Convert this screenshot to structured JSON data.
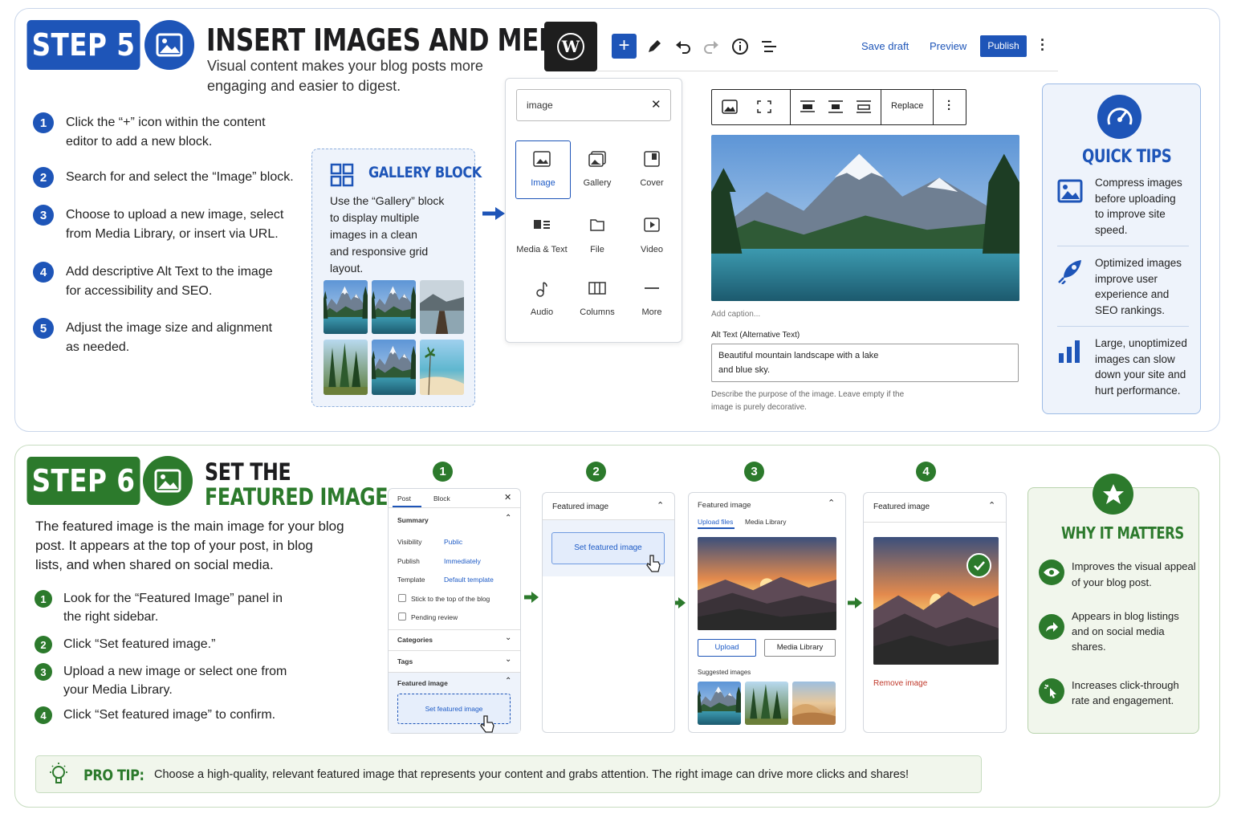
{
  "step5": {
    "badge": "STEP 5",
    "title": "INSERT IMAGES AND MEDIA",
    "subtitle_line1": "Visual content makes your blog posts more",
    "subtitle_line2": "engaging and easier to digest.",
    "steps": [
      {
        "n": "1",
        "l1": "Click the “+” icon within the content",
        "l2": "editor to add a new block."
      },
      {
        "n": "2",
        "l1": "Search for and select the “Image” block.",
        "l2": ""
      },
      {
        "n": "3",
        "l1": "Choose to upload a new image, select",
        "l2": "from Media Library, or insert via URL."
      },
      {
        "n": "4",
        "l1": "Add descriptive Alt Text to the image",
        "l2": "for accessibility and SEO."
      },
      {
        "n": "5",
        "l1": "Adjust the image size and alignment",
        "l2": "as needed."
      }
    ],
    "gallery": {
      "title": "GALLERY BLOCK",
      "lines": [
        "Use the “Gallery” block",
        "to display multiple",
        "images in a clean",
        "and responsive grid",
        "layout."
      ]
    },
    "toolbar": {
      "save_draft": "Save draft",
      "preview": "Preview",
      "publish": "Publish"
    },
    "inserter": {
      "search_value": "image",
      "blocks": [
        "Image",
        "Gallery",
        "Cover",
        "Media & Text",
        "File",
        "Video",
        "Audio",
        "Columns",
        "More"
      ]
    },
    "image_block": {
      "replace": "Replace",
      "caption_placeholder": "Add caption...",
      "alt_label": "Alt Text (Alternative Text)",
      "alt_line1": "Beautiful mountain landscape with a lake",
      "alt_line2": "and blue sky.",
      "help_line1": "Describe the purpose of the image. Leave empty if the",
      "help_line2": "image is purely decorative."
    },
    "tips": {
      "title": "QUICK TIPS",
      "items": [
        {
          "icon": "image-icon",
          "lines": [
            "Compress images",
            "before uploading",
            "to improve site",
            "speed."
          ]
        },
        {
          "icon": "rocket-icon",
          "lines": [
            "Optimized images",
            "improve user",
            "experience and",
            "SEO rankings."
          ]
        },
        {
          "icon": "bar-chart-icon",
          "lines": [
            "Large, unoptimized",
            "images can slow",
            "down your site and",
            "hurt performance."
          ]
        }
      ]
    }
  },
  "step6": {
    "badge": "STEP 6",
    "title_line1": "SET THE",
    "title_line2": "FEATURED IMAGE",
    "intro": [
      "The featured image is the main image for your blog",
      "post. It appears at the top of your post, in blog",
      "lists, and when shared on social media."
    ],
    "steps": [
      {
        "n": "1",
        "l1": "Look for the “Featured Image” panel in",
        "l2": "the right sidebar."
      },
      {
        "n": "2",
        "l1": "Click “Set featured image.”",
        "l2": ""
      },
      {
        "n": "3",
        "l1": "Upload a new image or select one from",
        "l2": "your Media Library."
      },
      {
        "n": "4",
        "l1": "Click “Set featured image” to confirm.",
        "l2": ""
      }
    ],
    "flow_numbers": [
      "1",
      "2",
      "3",
      "4"
    ],
    "sidebar": {
      "tab_post": "Post",
      "tab_block": "Block",
      "summary": "Summary",
      "visibility_label": "Visibility",
      "visibility_value": "Public",
      "publish_label": "Publish",
      "publish_value": "Immediately",
      "template_label": "Template",
      "template_value": "Default template",
      "stick": "Stick to the top of the blog",
      "pending": "Pending review",
      "categories": "Categories",
      "tags": "Tags",
      "featured": "Featured image",
      "set_featured": "Set featured image"
    },
    "panel2": {
      "title": "Featured image",
      "button": "Set featured image"
    },
    "panel3": {
      "title": "Featured image",
      "tab_upload": "Upload files",
      "tab_library": "Media Library",
      "upload_btn": "Upload",
      "library_btn": "Media Library",
      "suggested": "Suggested images"
    },
    "panel4": {
      "title": "Featured image",
      "remove": "Remove image"
    },
    "why": {
      "title": "WHY IT MATTERS",
      "items": [
        {
          "icon": "eye-icon",
          "lines": [
            "Improves the visual appeal",
            "of your blog post."
          ]
        },
        {
          "icon": "share-icon",
          "lines": [
            "Appears in blog listings",
            "and on social media",
            "shares."
          ]
        },
        {
          "icon": "click-icon",
          "lines": [
            "Increases click-through",
            "rate and engagement."
          ]
        }
      ]
    },
    "protip": {
      "label": "PRO TIP:",
      "text": "Choose a high-quality, relevant featured image that represents your content and grabs attention. The right image can drive more clicks and shares!"
    }
  },
  "colors": {
    "blue": "#1e55b8",
    "green": "#2c7a2c",
    "tipbg": "#eef3fb",
    "greenbg": "#f1f6ec"
  }
}
